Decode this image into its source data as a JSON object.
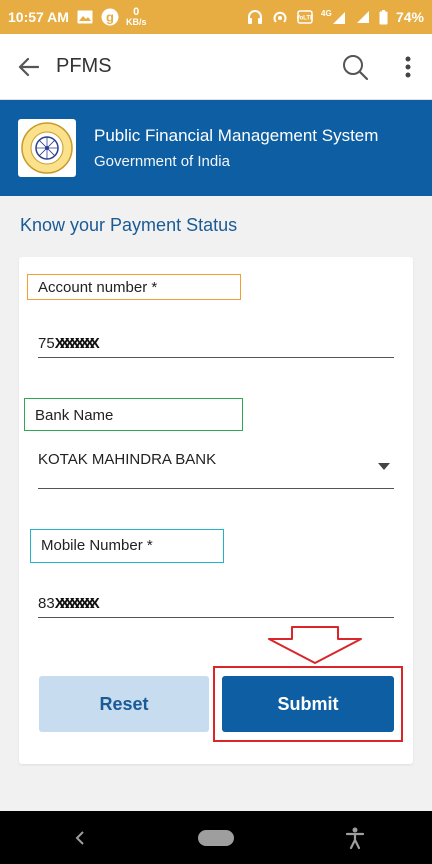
{
  "status_bar": {
    "time": "10:57 AM",
    "data_rate_value": "0",
    "data_rate_unit": "KB/s",
    "network_type": "4G",
    "battery": "74%"
  },
  "app_bar": {
    "title": "PFMS"
  },
  "banner": {
    "title": "Public Financial Management System",
    "subtitle": "Government of India"
  },
  "section": {
    "title": "Know your Payment Status"
  },
  "form": {
    "account_label": "Account number *",
    "account_value_prefix": "75",
    "account_value_masked": "XXXXXXXX",
    "bank_label": "Bank Name",
    "bank_value": "KOTAK MAHINDRA BANK",
    "mobile_label": "Mobile Number *",
    "mobile_value_prefix": "83",
    "mobile_value_masked": "XXXXXXXX"
  },
  "buttons": {
    "reset": "Reset",
    "submit": "Submit"
  },
  "colors": {
    "status_bar": "#e7ad42",
    "primary": "#0d5ea2",
    "reset_bg": "#c8dcef",
    "highlight_red": "#d8262b"
  },
  "icons": {
    "back": "arrow-left",
    "search": "search",
    "menu": "more-vertical",
    "dropdown": "triangle-down",
    "nav_back": "chevron-left",
    "accessibility": "accessibility"
  }
}
